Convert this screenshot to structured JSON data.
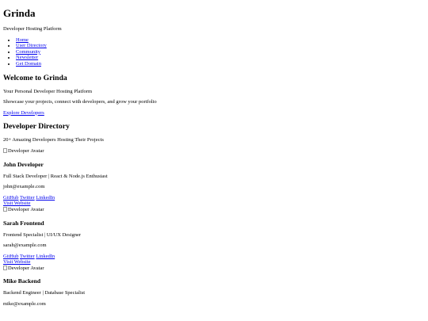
{
  "header": {
    "title": "Grinda",
    "tagline": "Developer Hosting Platform"
  },
  "nav": {
    "items": [
      {
        "label": "Home"
      },
      {
        "label": "User Directory"
      },
      {
        "label": "Community"
      },
      {
        "label": "Newsletter"
      },
      {
        "label": "Get Domain"
      }
    ]
  },
  "hero": {
    "heading": "Welcome to Grinda",
    "subheading": "Your Personal Developer Hosting Platform",
    "description": "Showcase your projects, connect with developers, and grow your portfolio",
    "cta_label": "Explore Developers"
  },
  "directory": {
    "heading": "Developer Directory",
    "subheading": "20+ Amazing Developers Hosting Their Projects",
    "developers": [
      {
        "avatar_alt": "Developer Avatar",
        "name": "John Developer",
        "role": "Full Stack Developer | React & Node.js Enthusiast",
        "email": "john@example.com",
        "github": "GitHub",
        "twitter": "Twitter",
        "linkedin": "LinkedIn",
        "website": "Visit Website"
      },
      {
        "avatar_alt": "Developer Avatar",
        "name": "Sarah Frontend",
        "role": "Frontend Specialist | UI/UX Designer",
        "email": "sarah@example.com",
        "github": "GitHub",
        "twitter": "Twitter",
        "linkedin": "LinkedIn",
        "website": "Visit Website"
      },
      {
        "avatar_alt": "Developer Avatar",
        "name": "Mike Backend",
        "role": "Backend Engineer | Database Specialist",
        "email": "mike@example.com"
      }
    ]
  }
}
